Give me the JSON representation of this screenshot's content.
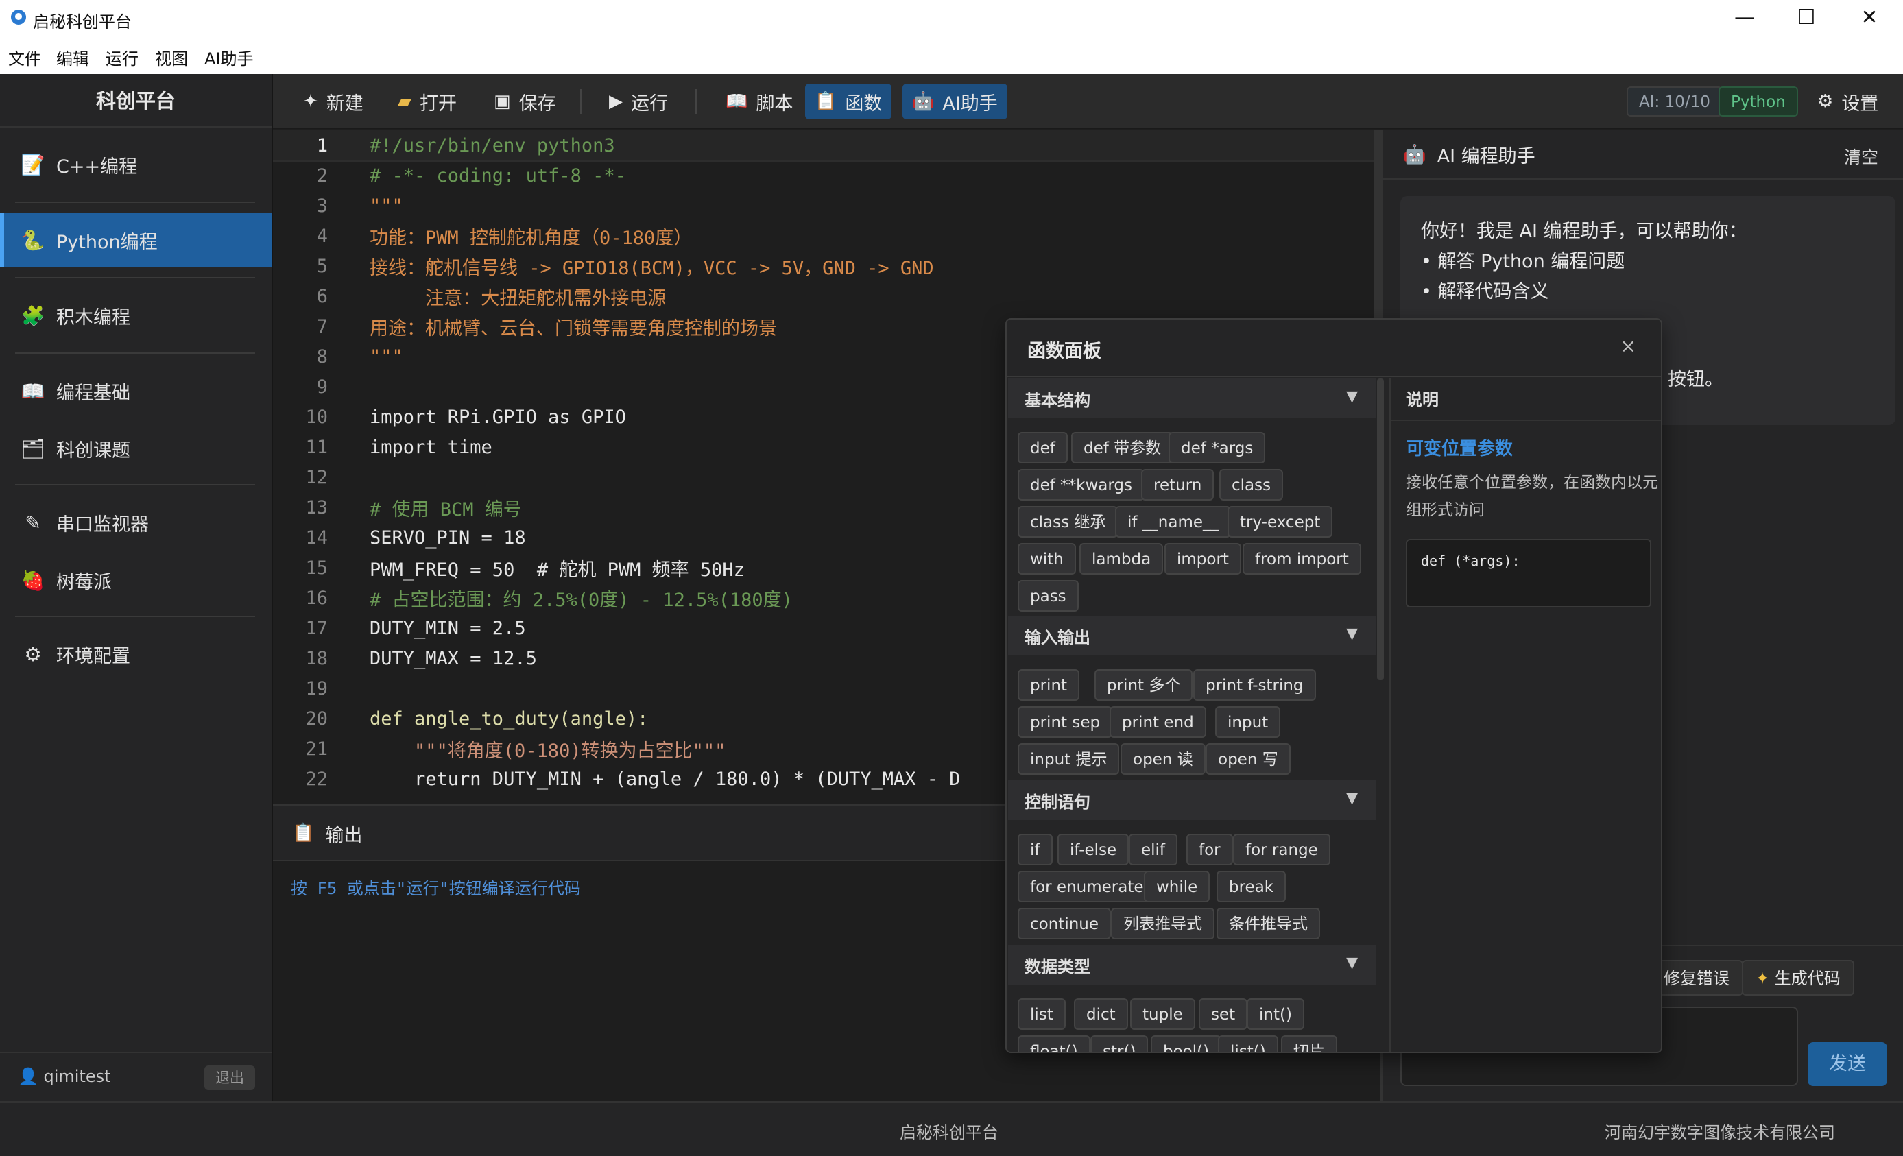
{
  "window": {
    "title": "启秘科创平台",
    "controls": {
      "minimize": "—",
      "maximize": "☐",
      "close": "✕"
    }
  },
  "menu": [
    "文件",
    "编辑",
    "运行",
    "视图",
    "AI助手"
  ],
  "sidebar": {
    "brand": "科创平台",
    "items": [
      {
        "label": "C++编程",
        "icon": "memo-icon"
      },
      {
        "label": "Python编程",
        "icon": "python-icon",
        "active": true
      },
      {
        "label": "积木编程",
        "icon": "puzzle-icon"
      },
      {
        "label": "编程基础",
        "icon": "book-icon"
      },
      {
        "label": "科创课题",
        "icon": "list-icon"
      },
      {
        "label": "串口监视器",
        "icon": "probe-icon"
      },
      {
        "label": "树莓派",
        "icon": "raspberry-icon"
      },
      {
        "label": "环境配置",
        "icon": "gear-icon"
      }
    ],
    "user": {
      "name": "qimitest",
      "logout": "退出"
    }
  },
  "toolbar": {
    "new": "新建",
    "open": "打开",
    "save": "保存",
    "run": "运行",
    "script": "脚本",
    "functions": "函数",
    "ai_helper": "AI助手",
    "ai_count": "AI: 10/10",
    "language": "Python",
    "settings": "设置"
  },
  "editor": {
    "current_line": 1,
    "lines": [
      "#!/usr/bin/env python3",
      "# -*- coding: utf-8 -*-",
      "\"\"\"",
      "功能：PWM 控制舵机角度（0-180度）",
      "接线：舵机信号线 -> GPIO18(BCM)，VCC -> 5V，GND -> GND",
      "     注意：大扭矩舵机需外接电源",
      "用途：机械臂、云台、门锁等需要角度控制的场景",
      "\"\"\"",
      "",
      "import RPi.GPIO as GPIO",
      "import time",
      "",
      "# 使用 BCM 编号",
      "SERVO_PIN = 18",
      "PWM_FREQ = 50  # 舵机 PWM 频率 50Hz",
      "# 占空比范围：约 2.5%(0度) - 12.5%(180度)",
      "DUTY_MIN = 2.5",
      "DUTY_MAX = 12.5",
      "",
      "def angle_to_duty(angle):",
      "    \"\"\"将角度(0-180)转换为占空比\"\"\"",
      "    return DUTY_MIN + (angle / 180.0) * (DUTY_MAX - D"
    ]
  },
  "output": {
    "title": "输出",
    "message": "按 F5 或点击\"运行\"按钮编译运行代码"
  },
  "ai_panel": {
    "title": "AI 编程助手",
    "clear": "清空",
    "greeting": "你好！我是 AI 编程助手，可以帮助你：",
    "bullets": [
      "解答 Python 编程问题",
      "解释代码含义"
    ],
    "tail": "按钮。",
    "fix_button": "修复错误",
    "generate_button": "生成代码",
    "send": "发送"
  },
  "function_panel": {
    "title": "函数面板",
    "close": "×",
    "categories": [
      {
        "name": "基本结构",
        "items": [
          "def",
          "def 带参数",
          "def *args",
          "def **kwargs",
          "return",
          "class",
          "class 继承",
          "if __name__",
          "try-except",
          "with",
          "lambda",
          "import",
          "from import",
          "pass"
        ]
      },
      {
        "name": "输入输出",
        "items": [
          "print",
          "print 多个",
          "print f-string",
          "print sep",
          "print end",
          "input",
          "input 提示",
          "open 读",
          "open 写"
        ]
      },
      {
        "name": "控制语句",
        "items": [
          "if",
          "if-else",
          "elif",
          "for",
          "for range",
          "for enumerate",
          "while",
          "break",
          "continue",
          "列表推导式",
          "条件推导式"
        ]
      },
      {
        "name": "数据类型",
        "items": [
          "list",
          "dict",
          "tuple",
          "set",
          "int()",
          "float()",
          "str()",
          "bool()",
          "list()",
          "切片"
        ]
      }
    ],
    "description": {
      "header": "说明",
      "name": "可变位置参数",
      "text": "接收任意个位置参数，在函数内以元组形式访问",
      "code": "def (*args):"
    }
  },
  "statusbar": {
    "center": "启秘科创平台",
    "right": "河南幻宇数字图像技术有限公司"
  }
}
